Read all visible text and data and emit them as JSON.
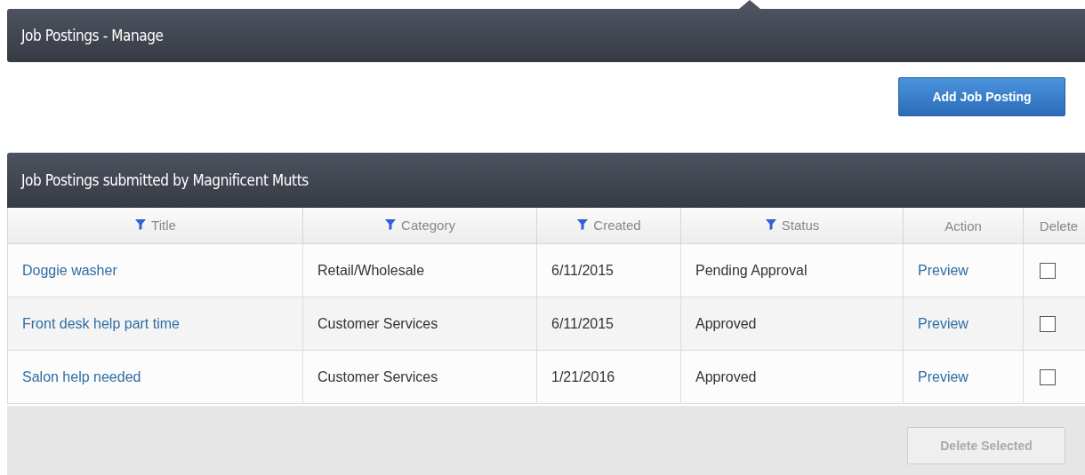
{
  "page_header": {
    "title": "Job Postings - Manage"
  },
  "add_button": {
    "label": "Add Job Posting"
  },
  "panel": {
    "title": "Job Postings submitted by Magnificent Mutts"
  },
  "table": {
    "columns": [
      {
        "label": "Title",
        "filter": true
      },
      {
        "label": "Category",
        "filter": true
      },
      {
        "label": "Created",
        "filter": true
      },
      {
        "label": "Status",
        "filter": true
      },
      {
        "label": "Action",
        "filter": false
      },
      {
        "label": "Delete",
        "filter": false
      }
    ],
    "rows": [
      {
        "title": "Doggie washer",
        "category": "Retail/Wholesale",
        "created": "6/11/2015",
        "status": "Pending Approval",
        "action": "Preview",
        "checked": false
      },
      {
        "title": "Front desk help part time",
        "category": "Customer Services",
        "created": "6/11/2015",
        "status": "Approved",
        "action": "Preview",
        "checked": false
      },
      {
        "title": "Salon help needed",
        "category": "Customer Services",
        "created": "1/21/2016",
        "status": "Approved",
        "action": "Preview",
        "checked": false
      }
    ]
  },
  "delete_button": {
    "label": "Delete Selected",
    "disabled": true
  }
}
